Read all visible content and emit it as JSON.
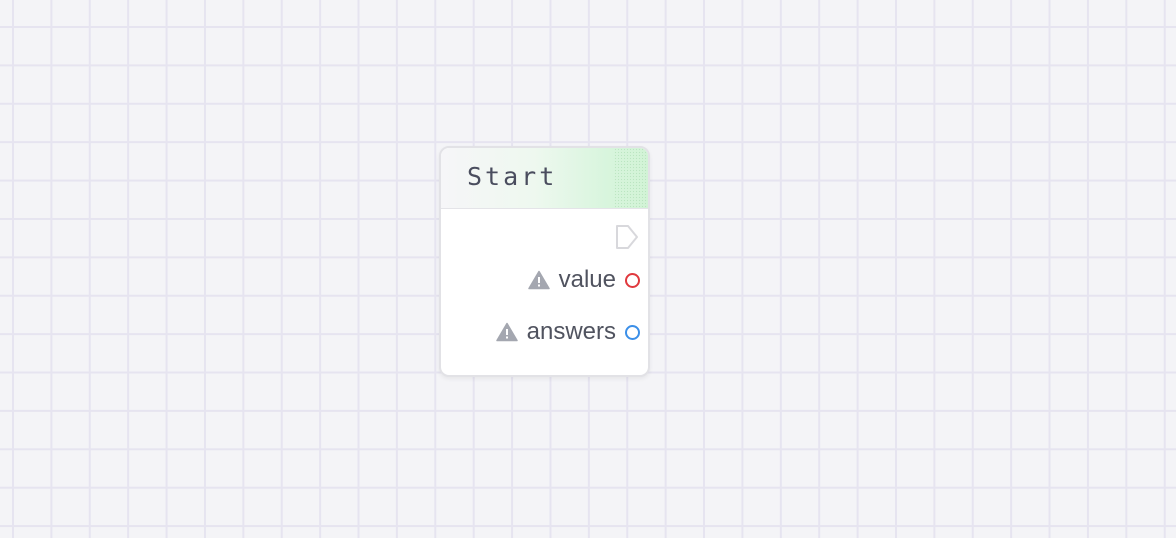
{
  "node": {
    "title": "Start",
    "header_accent": "#d2f3d6",
    "outputs": [
      {
        "label": "value",
        "warning_icon": "warning-triangle-icon",
        "port_color": "#e0393e"
      },
      {
        "label": "answers",
        "warning_icon": "warning-triangle-icon",
        "port_color": "#3b8fe8"
      }
    ],
    "exec_port_icon": "exec-output-icon"
  },
  "canvas": {
    "background": "#f4f4f7",
    "grid_color": "#e6e4f0"
  }
}
